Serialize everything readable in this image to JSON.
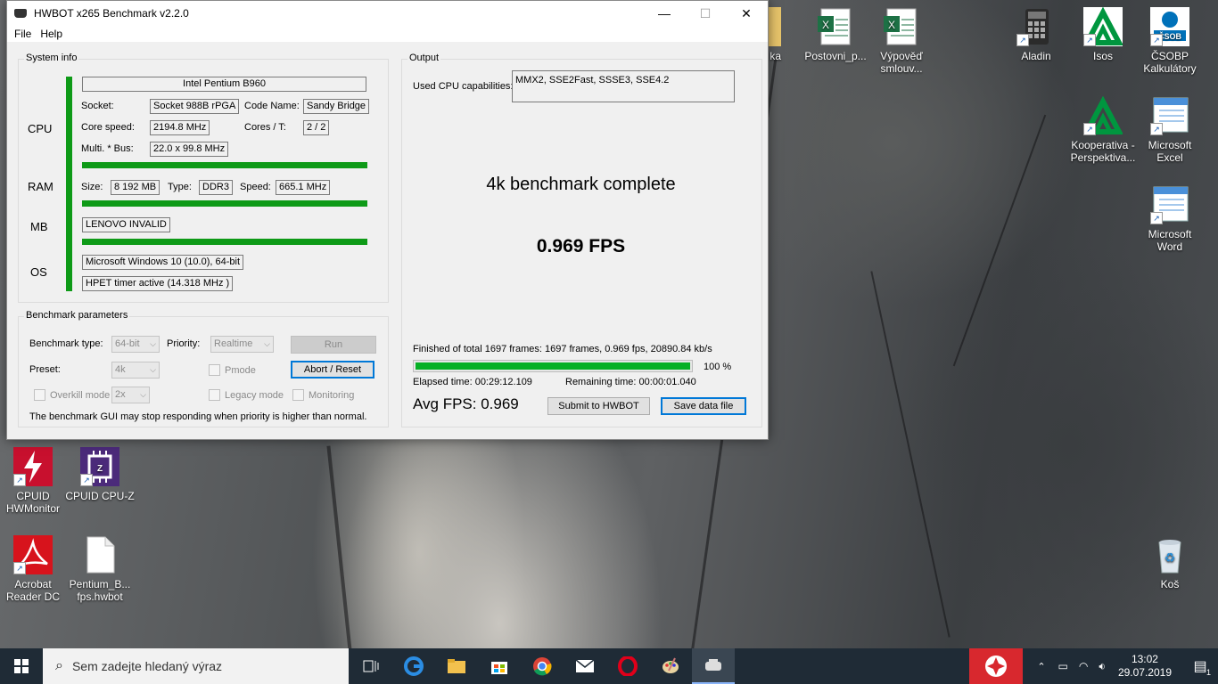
{
  "window": {
    "title": "HWBOT x265 Benchmark v2.2.0",
    "menu": [
      "File",
      "Help"
    ],
    "controls": {
      "minimize": "—",
      "maximize": "☐",
      "close": "✕"
    }
  },
  "sysinfo": {
    "group_label": "System info",
    "cpu": {
      "section_label": "CPU",
      "name": "Intel Pentium B960",
      "socket_label": "Socket:",
      "socket": "Socket 988B rPGA",
      "codename_label": "Code Name:",
      "codename": "Sandy Bridge",
      "speed_label": "Core speed:",
      "speed": "2194.8 MHz",
      "cores_label": "Cores / T:",
      "cores": "2 / 2",
      "multi_label": "Multi. * Bus:",
      "multi": "22.0 x 99.8 MHz"
    },
    "ram": {
      "section_label": "RAM",
      "size_label": "Size:",
      "size": "8 192 MB",
      "type_label": "Type:",
      "type": "DDR3",
      "speed_label": "Speed:",
      "speed": "665.1 MHz"
    },
    "mb": {
      "section_label": "MB",
      "value": "LENOVO INVALID"
    },
    "os": {
      "section_label": "OS",
      "value": "Microsoft Windows 10 (10.0), 64-bit",
      "timer": "HPET timer active (14.318 MHz )"
    }
  },
  "params": {
    "group_label": "Benchmark parameters",
    "type_label": "Benchmark type:",
    "type": "64-bit",
    "priority_label": "Priority:",
    "priority": "Realtime",
    "run_label": "Run",
    "preset_label": "Preset:",
    "preset": "4k",
    "pmode_label": "Pmode",
    "abort_label": "Abort / Reset",
    "overkill_label": "Overkill mode",
    "overkill": "2x",
    "legacy_label": "Legacy mode",
    "monitoring_label": "Monitoring",
    "warning": "The benchmark GUI may stop responding when priority is higher than normal."
  },
  "output": {
    "group_label": "Output",
    "cpu_caps_label": "Used CPU capabilities:",
    "cpu_caps": "MMX2, SSE2Fast, SSSE3, SSE4.2",
    "status": "4k benchmark complete",
    "fps": "0.969 FPS",
    "finished": "Finished of total 1697 frames: 1697 frames, 0.969 fps,  20890.84 kb/s",
    "progress": 1.0,
    "progress_text": "100 %",
    "elapsed": "Elapsed time: 00:29:12.109",
    "remaining": "Remaining time: 00:00:01.040",
    "avg_fps": "Avg FPS: 0.969",
    "submit_label": "Submit to HWBOT",
    "save_label": "Save data file"
  },
  "desktop_icons": [
    {
      "name": "icon-partial",
      "label": "ka"
    },
    {
      "name": "icon-postovni",
      "label": "Postovni_p..."
    },
    {
      "name": "icon-vypoved",
      "label": "Výpověď smlouv..."
    },
    {
      "name": "icon-aladin",
      "label": "Aladin"
    },
    {
      "name": "icon-isos",
      "label": "Isos"
    },
    {
      "name": "icon-csob",
      "label": "ČSOBP Kalkulátory"
    },
    {
      "name": "icon-kooperativa",
      "label": "Kooperativa - Perspektiva..."
    },
    {
      "name": "icon-excel",
      "label": "Microsoft Excel"
    },
    {
      "name": "icon-word",
      "label": "Microsoft Word"
    },
    {
      "name": "icon-hwmonitor",
      "label": "CPUID HWMonitor"
    },
    {
      "name": "icon-cpuz",
      "label": "CPUID CPU-Z"
    },
    {
      "name": "icon-acrobat",
      "label": "Acrobat Reader DC"
    },
    {
      "name": "icon-hwbot-file",
      "label": "Pentium_B... fps.hwbot"
    },
    {
      "name": "icon-recycle",
      "label": "Koš"
    }
  ],
  "taskbar": {
    "search_placeholder": "Sem zadejte hledaný výraz",
    "time": "13:02",
    "date": "29.07.2019",
    "notif_count": "1"
  },
  "colors": {
    "progress_green": "#06b025",
    "separator_green": "#0e9a17",
    "taskbar": "#1f2b36"
  }
}
